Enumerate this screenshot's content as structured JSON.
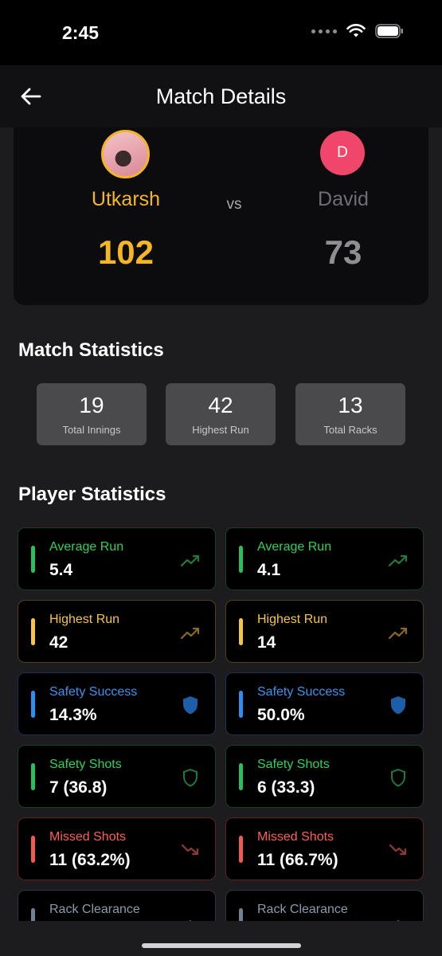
{
  "status_bar": {
    "time": "2:45"
  },
  "nav": {
    "title": "Match Details"
  },
  "match": {
    "vs_label": "vs",
    "player1": {
      "name": "Utkarsh",
      "score": "102"
    },
    "player2": {
      "name": "David",
      "initial": "D",
      "score": "73"
    }
  },
  "match_statistics": {
    "title": "Match Statistics",
    "items": [
      {
        "value": "19",
        "label": "Total Innings"
      },
      {
        "value": "42",
        "label": "Highest Run"
      },
      {
        "value": "13",
        "label": "Total Racks"
      }
    ]
  },
  "player_statistics": {
    "title": "Player Statistics",
    "rows": [
      {
        "label": "Average Run",
        "icon": "trending-up-icon",
        "p1": "5.4",
        "p2": "4.1"
      },
      {
        "label": "Highest Run",
        "icon": "trending-up-icon",
        "p1": "42",
        "p2": "14"
      },
      {
        "label": "Safety Success",
        "icon": "shield-filled-icon",
        "p1": "14.3%",
        "p2": "50.0%"
      },
      {
        "label": "Safety Shots",
        "icon": "shield-outline-icon",
        "p1": "7 (36.8)",
        "p2": "6 (33.3)"
      },
      {
        "label": "Missed Shots",
        "icon": "trending-down-icon",
        "p1": "11 (63.2%)",
        "p2": "11 (66.7%)"
      },
      {
        "label": "Rack Clearance",
        "icon": "chevron-up-icon",
        "p1": "",
        "p2": ""
      }
    ]
  },
  "colors": {
    "accent_yellow": "#f5b623",
    "avatar_pink": "#f0466b",
    "green": "#30d158",
    "yellow": "#f7c546",
    "blue": "#3a94f0",
    "red": "#ff5f57",
    "slate": "#8a9bab"
  }
}
